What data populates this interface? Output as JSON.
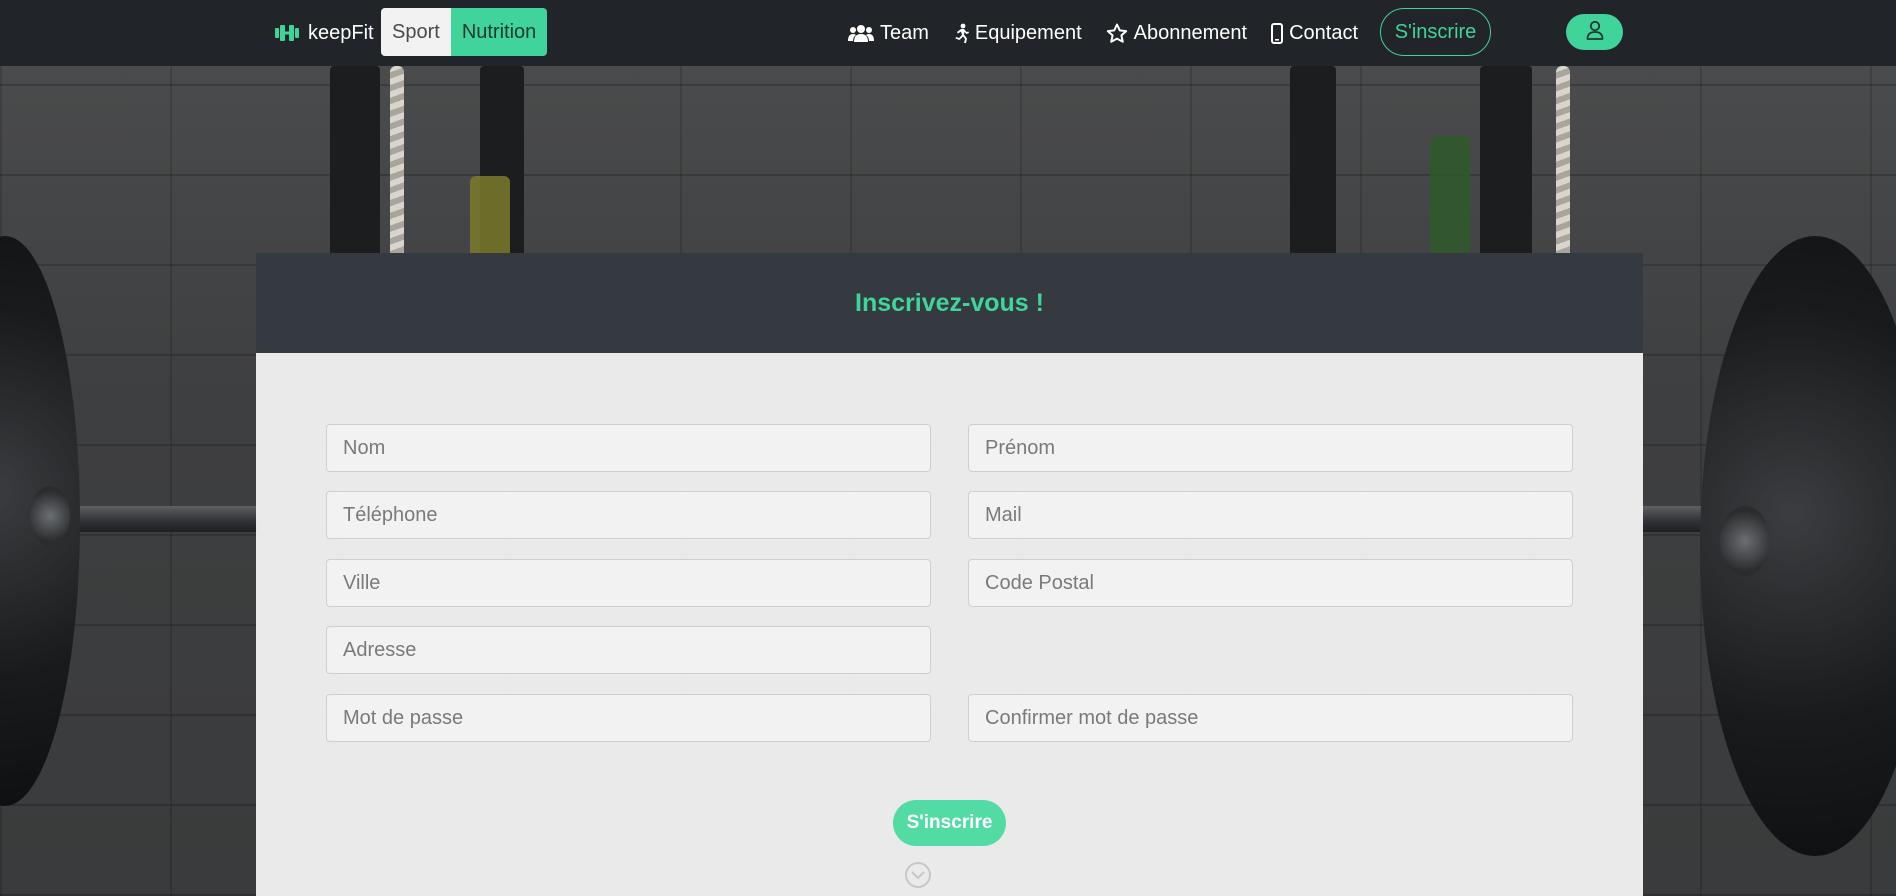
{
  "brand": {
    "name": "keepFit",
    "icon": "dumbbell-icon"
  },
  "toggle": {
    "sport": "Sport",
    "nutrition": "Nutrition",
    "active": "Nutrition"
  },
  "nav": {
    "links": [
      {
        "label": "Team",
        "icon": "users-icon"
      },
      {
        "label": "Equipement",
        "icon": "running-icon"
      },
      {
        "label": "Abonnement",
        "icon": "star-icon"
      },
      {
        "label": "Contact",
        "icon": "mobile-icon"
      }
    ],
    "signup": "S'inscrire",
    "user_icon": "user-icon"
  },
  "form": {
    "title": "Inscrivez-vous !",
    "fields": {
      "nom": "Nom",
      "prenom": "Prénom",
      "telephone": "Téléphone",
      "mail": "Mail",
      "ville": "Ville",
      "code_postal": "Code Postal",
      "adresse": "Adresse",
      "mot_de_passe": "Mot de passe",
      "confirmer": "Confirmer mot de passe"
    },
    "submit": "S'inscrire"
  },
  "colors": {
    "accent": "#40d39a",
    "navbar": "#212529",
    "card_header": "#343a40"
  }
}
